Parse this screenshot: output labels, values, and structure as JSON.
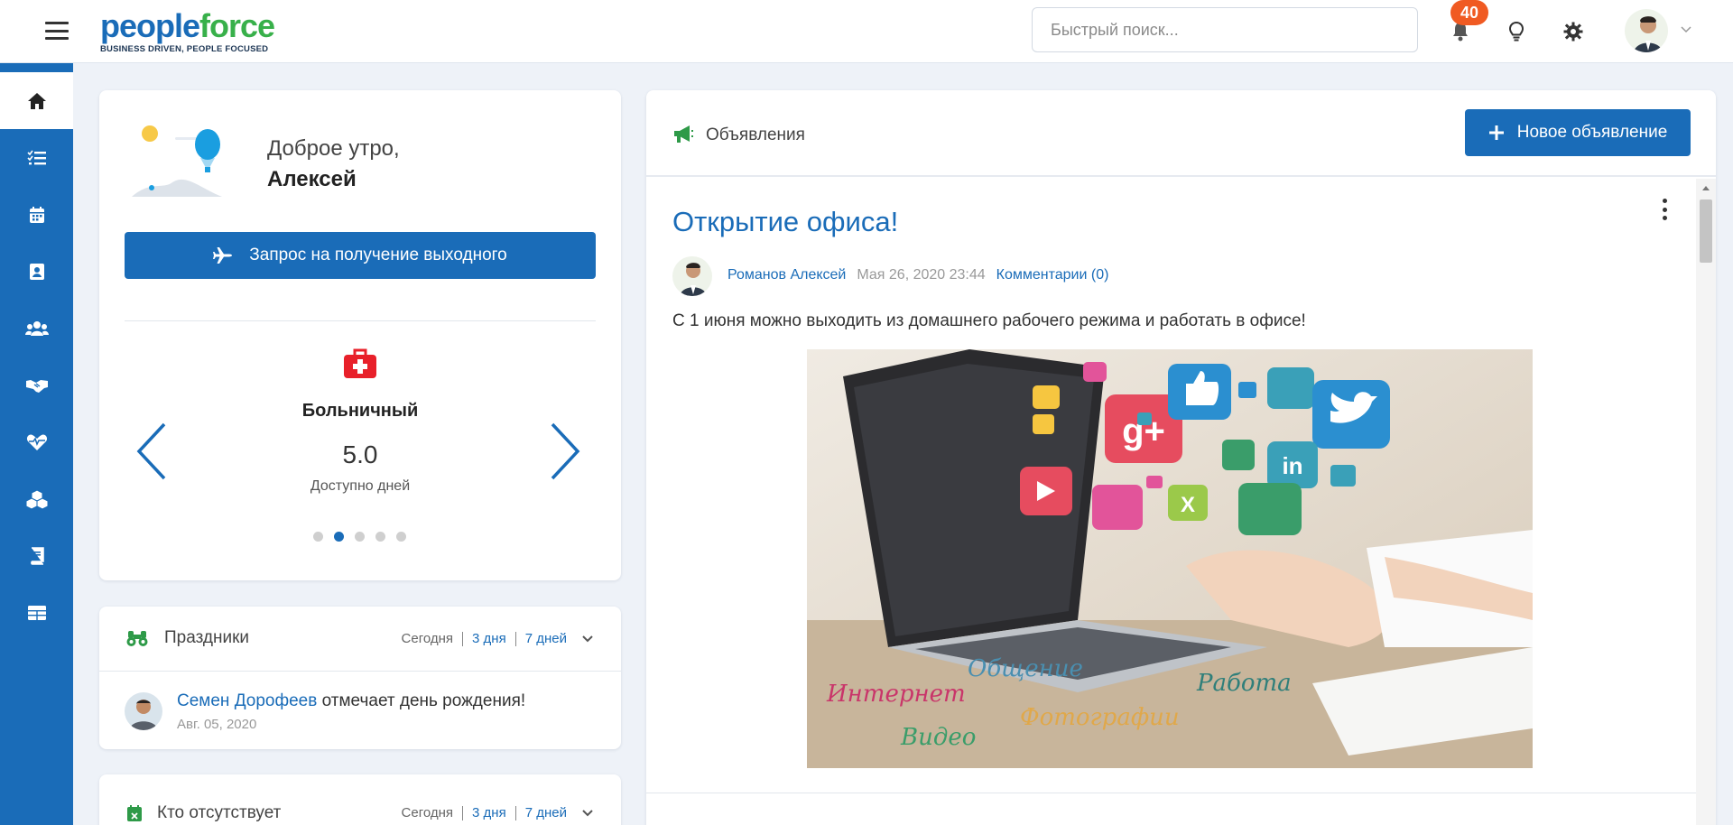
{
  "header": {
    "logo": {
      "part1": "people",
      "part2": "force",
      "tagline": "BUSINESS DRIVEN, PEOPLE FOCUSED"
    },
    "search": {
      "placeholder": "Быстрый поиск..."
    },
    "notifications_count": "40",
    "icons": [
      "menu-icon",
      "bell-icon",
      "lightbulb-icon",
      "gear-icon",
      "chevron-down-icon"
    ]
  },
  "sidebar": {
    "items": [
      {
        "icon": "home-icon",
        "active": true
      },
      {
        "icon": "checklist-icon"
      },
      {
        "icon": "calendar-icon"
      },
      {
        "icon": "contact-card-icon"
      },
      {
        "icon": "users-icon"
      },
      {
        "icon": "handshake-icon"
      },
      {
        "icon": "heart-pulse-icon"
      },
      {
        "icon": "cubes-icon"
      },
      {
        "icon": "book-icon"
      },
      {
        "icon": "table-icon"
      }
    ]
  },
  "greeting": {
    "line1": "Доброе утро,",
    "name": "Алексей",
    "button_label": "Запрос на получение выходного"
  },
  "leave": {
    "type": "Больничный",
    "value": "5.0",
    "label": "Доступно дней",
    "active_dot": 1,
    "dots": 5
  },
  "holidays": {
    "title": "Праздники",
    "filters": [
      "Сегодня",
      "3 дня",
      "7 дней"
    ],
    "item": {
      "person": "Семен Дорофеев",
      "text": " отмечает день рождения!",
      "date": "Авг. 05, 2020"
    }
  },
  "absent": {
    "title": "Кто отсутствует",
    "filters": [
      "Сегодня",
      "3 дня",
      "7 дней"
    ]
  },
  "announcements": {
    "title": "Объявления",
    "new_button": "Новое объявление",
    "post": {
      "title": "Открытие офиса!",
      "author": "Романов Алексей",
      "date": "Мая 26, 2020 23:44",
      "comments": "Комментарии (0)",
      "body": "С 1 июня можно выходить из домашнего рабочего режима и работать в офисе!",
      "image_words": [
        "Интернет",
        "Общение",
        "Работа",
        "Видео",
        "Фотографии"
      ]
    }
  },
  "colors": {
    "brand": "#1a6cb8",
    "green": "#38b04a",
    "badge": "#f05a22",
    "medical": "#e8202a"
  }
}
